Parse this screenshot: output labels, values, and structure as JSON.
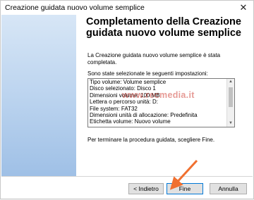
{
  "window": {
    "title": "Creazione guidata nuovo volume semplice",
    "close_glyph": "✕"
  },
  "main": {
    "heading": "Completamento della Creazione guidata nuovo volume semplice",
    "intro": "La Creazione guidata nuovo volume semplice è stata completata.",
    "settings_label": "Sono state selezionate le seguenti impostazioni:",
    "settings": [
      "Tipo volume: Volume semplice",
      "Disco selezionato: Disco 1",
      "Dimensioni volume: 100 MB",
      "Lettera o percorso unità: D:",
      "File system: FAT32",
      "Dimensioni unità di allocazione: Predefinita",
      "Etichetta volume: Nuovo volume"
    ],
    "finish_hint": "Per terminare la procedura guidata, scegliere Fine."
  },
  "watermark": "www.recmedia.it",
  "buttons": {
    "back": "< Indietro",
    "finish": "Fine",
    "cancel": "Annulla"
  },
  "colors": {
    "annotation_arrow": "#f07030",
    "default_button_border": "#0078d7"
  }
}
